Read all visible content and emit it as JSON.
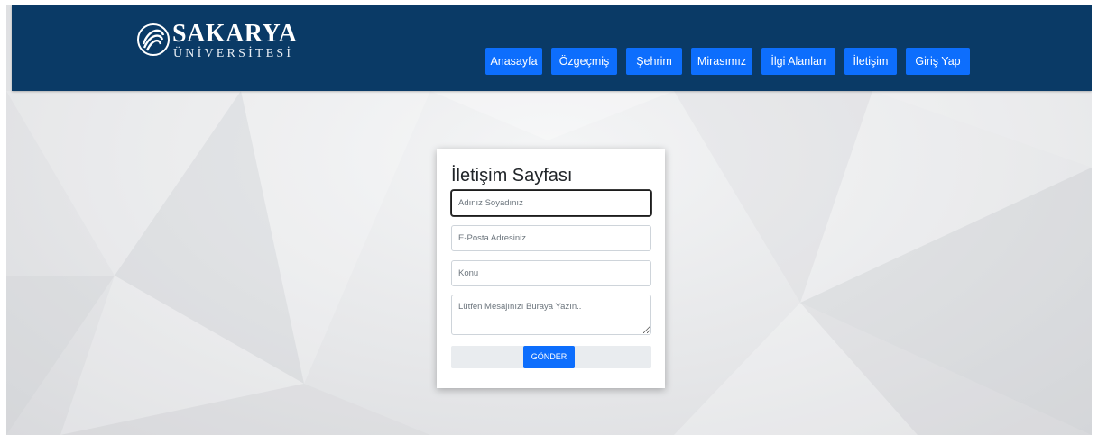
{
  "brand": {
    "name": "SAKARYA",
    "subtitle": "ÜNİVERSİTESİ",
    "colors": {
      "header": "#0a3a66",
      "accent": "#0d6efd"
    }
  },
  "nav": {
    "items": [
      {
        "label": "Anasayfa"
      },
      {
        "label": "Özgeçmiş"
      },
      {
        "label": "Şehrim"
      },
      {
        "label": "Mirasımız"
      },
      {
        "label": "İlgi Alanları"
      },
      {
        "label": "İletişim"
      },
      {
        "label": "Giriş Yap"
      }
    ]
  },
  "contact_form": {
    "title": "İletişim Sayfası",
    "name_placeholder": "Adınız Soyadınız",
    "email_placeholder": "E-Posta Adresiniz",
    "subject_placeholder": "Konu",
    "message_placeholder": "Lütfen Mesajınızı Buraya Yazın..",
    "submit_label": "GÖNDER"
  }
}
